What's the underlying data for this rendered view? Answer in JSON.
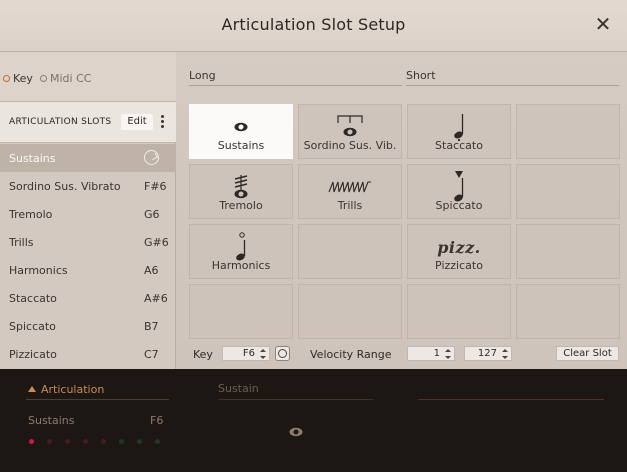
{
  "dialog": {
    "title": "Articulation Slot Setup",
    "close_icon": "close-icon"
  },
  "mode": {
    "options": [
      {
        "label": "Key",
        "selected": true
      },
      {
        "label": "Midi CC",
        "selected": false
      }
    ]
  },
  "slots": {
    "header": "ARTICULATION SLOTS",
    "edit_label": "Edit",
    "items": [
      {
        "name": "Sustains",
        "key": "",
        "selected": true
      },
      {
        "name": "Sordino Sus. Vibrato",
        "key": "F#6"
      },
      {
        "name": "Tremolo",
        "key": "G6"
      },
      {
        "name": "Trills",
        "key": "G#6"
      },
      {
        "name": "Harmonics",
        "key": "A6"
      },
      {
        "name": "Staccato",
        "key": "A#6"
      },
      {
        "name": "Spiccato",
        "key": "B7"
      },
      {
        "name": "Pizzicato",
        "key": "C7"
      }
    ]
  },
  "grid": {
    "long_label": "Long",
    "short_label": "Short",
    "cells": [
      {
        "label": "Sustains",
        "icon": "sustain-notehead-icon",
        "selected": true
      },
      {
        "label": "Sordino Sus. Vib.",
        "icon": "sordino-notehead-icon"
      },
      {
        "label": "Staccato",
        "icon": "staccato-note-icon"
      },
      {
        "label": "",
        "icon": ""
      },
      {
        "label": "Tremolo",
        "icon": "tremolo-note-icon"
      },
      {
        "label": "Trills",
        "icon": "trill-wave-icon"
      },
      {
        "label": "Spiccato",
        "icon": "spiccato-note-icon"
      },
      {
        "label": "",
        "icon": ""
      },
      {
        "label": "Harmonics",
        "icon": "harmonic-note-icon"
      },
      {
        "label": "",
        "icon": ""
      },
      {
        "label": "Pizzicato",
        "icon": "pizz-text-icon",
        "icon_text": "pizz."
      },
      {
        "label": "",
        "icon": ""
      },
      {
        "label": "",
        "icon": ""
      },
      {
        "label": "",
        "icon": ""
      },
      {
        "label": "",
        "icon": ""
      },
      {
        "label": "",
        "icon": ""
      }
    ]
  },
  "footer": {
    "key_label": "Key",
    "key_value": "F6",
    "velocity_label": "Velocity Range",
    "velocity_min": "1",
    "velocity_max": "127",
    "clear_label": "Clear Slot"
  },
  "bottom": {
    "tab_label": "Articulation",
    "current_name": "Sustains",
    "current_key": "F6",
    "sustain_label": "Sustain",
    "leds": [
      "#d4144a",
      "#4a1a22",
      "#4a1a22",
      "#4a1a22",
      "#4a1a22",
      "#1e3a22",
      "#1e3a22",
      "#1e3a22"
    ]
  },
  "colors": {
    "accent": "#c4702e",
    "selected_row": "#bfb2a7",
    "dialog_bg": "#d4c9c0",
    "dark_bg": "#1d1713"
  }
}
